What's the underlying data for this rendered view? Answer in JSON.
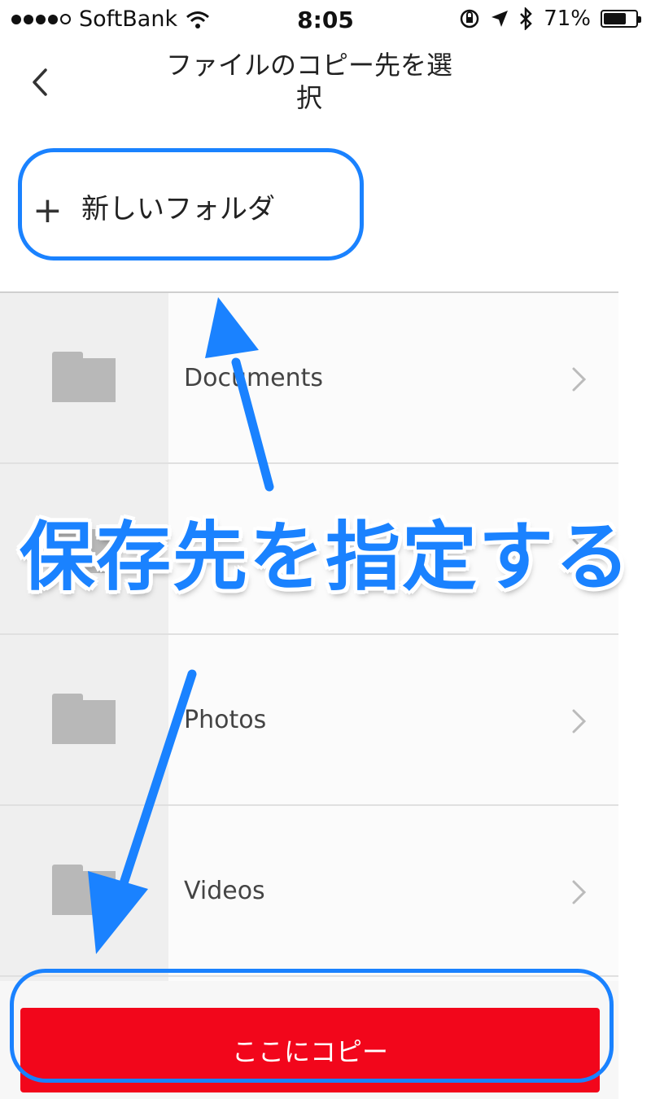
{
  "status_bar": {
    "carrier": "SoftBank",
    "time": "8:05",
    "battery": "71%",
    "battery_level": 0.71
  },
  "header": {
    "title": "ファイルのコピー先を選択"
  },
  "new_folder": {
    "label": "新しいフォルダ"
  },
  "folders": [
    {
      "name": "Documents"
    },
    {
      "name": ""
    },
    {
      "name": "Photos"
    },
    {
      "name": "Videos"
    }
  ],
  "copy_button": {
    "label": "ここにコピー"
  },
  "annotation": {
    "text": "保存先を指定する"
  },
  "colors": {
    "accent_blue": "#1a82ff",
    "copy_red": "#f2061b"
  }
}
